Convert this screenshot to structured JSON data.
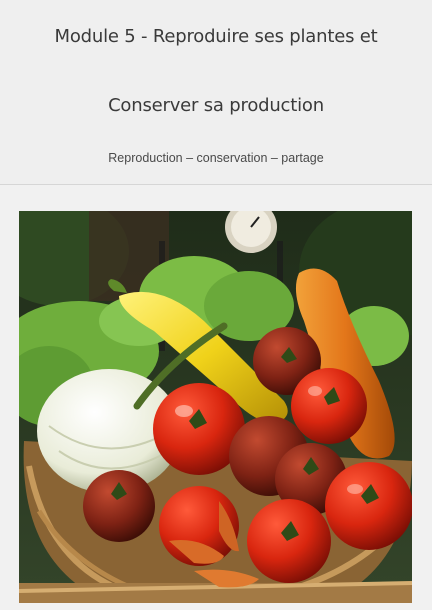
{
  "header": {
    "title_line1": "Module 5 - Reproduire ses plantes et",
    "title_line2": "Conserver sa production",
    "subtitle": "Reproduction – conservation – partage"
  },
  "photo": {
    "subject": "basket-of-vegetables"
  },
  "colors": {
    "background": "#f1f1f1",
    "title_text": "#3a3a3a",
    "divider": "#d6d6d6"
  }
}
